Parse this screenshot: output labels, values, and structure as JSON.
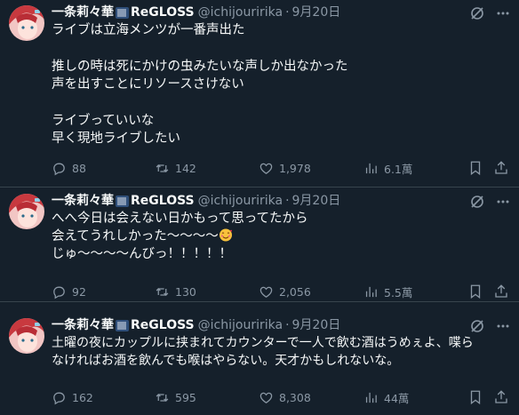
{
  "tweets": [
    {
      "name": "一条莉々華",
      "brand": "ReGLOSS",
      "handle": "@ichijouririka",
      "dot": "·",
      "date": "9月20日",
      "lines": [
        "ライブは立海メンツが一番声出た",
        "",
        "推しの時は死にかけの虫みたいな声しか出なかった",
        "声を出すことにリソースさけない",
        "",
        "ライブっていいな",
        "早く現地ライブしたい"
      ],
      "replies": "88",
      "retweets": "142",
      "likes": "1,978",
      "views": "6.1萬"
    },
    {
      "name": "一条莉々華",
      "brand": "ReGLOSS",
      "handle": "@ichijouririka",
      "dot": "·",
      "date": "9月20日",
      "lines": [
        "へへ今日は会えない日かもって思ってたから",
        "会えてうれしかった～～～～",
        "じゅ～～～～んびっ！！！！！"
      ],
      "replies": "92",
      "retweets": "130",
      "likes": "2,056",
      "views": "5.5萬"
    },
    {
      "name": "一条莉々華",
      "brand": "ReGLOSS",
      "handle": "@ichijouririka",
      "dot": "·",
      "date": "9月20日",
      "lines": [
        "土曜の夜にカップルに挟まれてカウンターで一人で飲む酒はうめぇよ、喋ら",
        "なければお酒を飲んでも喉はやらない。天才かもしれないな。"
      ],
      "replies": "162",
      "retweets": "595",
      "likes": "8,308",
      "views": "44萬"
    }
  ],
  "icons": {
    "reply": "reply-icon",
    "retweet": "retweet-icon",
    "like": "heart-icon",
    "views": "views-icon",
    "bookmark": "bookmark-icon",
    "share": "share-icon",
    "grok": "grok-icon",
    "more": "more-icon"
  },
  "colors": {
    "background": "#15202b",
    "text": "#f7f9f9",
    "muted": "#8b98a5",
    "divider": "#38444d"
  }
}
